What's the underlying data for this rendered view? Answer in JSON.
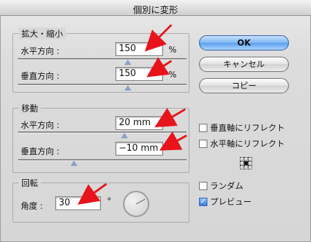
{
  "window": {
    "title": "個別に変形"
  },
  "scale": {
    "legend": "拡大・縮小",
    "horizontal": {
      "label": "水平方向 :",
      "value": "150",
      "unit": "%",
      "slider_fraction": 0.58
    },
    "vertical": {
      "label": "垂直方向 :",
      "value": "150",
      "unit": "%",
      "slider_fraction": 0.58
    }
  },
  "move": {
    "legend": "移動",
    "horizontal": {
      "label": "水平方向 :",
      "value": "20 mm",
      "slider_fraction": 0.62
    },
    "vertical": {
      "label": "垂直方向 :",
      "value": "−10 mm",
      "slider_fraction": 0.38
    }
  },
  "rotate": {
    "legend": "回転",
    "angle": {
      "label": "角度 :",
      "value": "30",
      "unit": "°"
    }
  },
  "buttons": {
    "ok": "OK",
    "cancel": "キャンセル",
    "copy": "コピー"
  },
  "options": {
    "reflect_vertical": {
      "label": "垂直軸にリフレクト",
      "checked": false
    },
    "reflect_horizontal": {
      "label": "水平軸にリフレクト",
      "checked": false
    },
    "random": {
      "label": "ランダム",
      "checked": false
    },
    "preview": {
      "label": "プレビュー",
      "checked": true
    }
  },
  "colors": {
    "arrow": "#e8141b",
    "primary_button": "#5d9ef0"
  },
  "icons": {
    "checkmark": "checkmark-icon",
    "reference_point": "reference-point-icon",
    "angle_dial": "angle-dial-icon"
  }
}
